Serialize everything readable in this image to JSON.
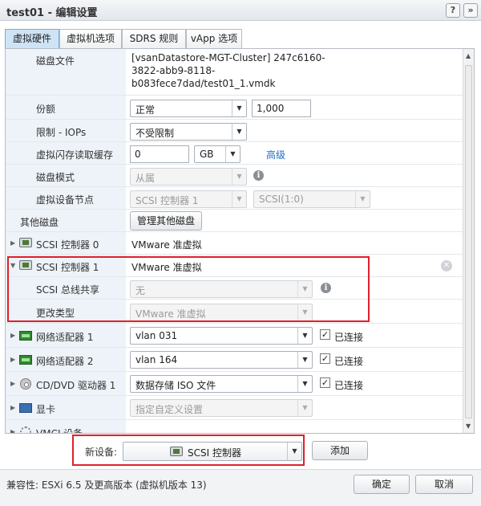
{
  "window": {
    "title": "test01 - 编辑设置",
    "help_glyph": "?",
    "expand_glyph": "»"
  },
  "tabs": [
    {
      "label": "虚拟硬件",
      "active": true
    },
    {
      "label": "虚拟机选项",
      "active": false
    },
    {
      "label": "SDRS 规则",
      "active": false
    },
    {
      "label": "vApp 选项",
      "active": false
    }
  ],
  "disk": {
    "file_label": "磁盘文件",
    "file_lines": [
      "[vsanDatastore-MGT-Cluster] 247c6160-",
      "3822-abb9-8118-",
      "b083fece7dad/test01_1.vmdk"
    ],
    "shares_label": "份额",
    "shares_value": "正常",
    "shares_number": "1,000",
    "limit_label": "限制 - IOPs",
    "limit_value": "不受限制",
    "flash_label": "虚拟闪存读取缓存",
    "flash_value": "0",
    "flash_unit": "GB",
    "flash_advanced": "高级",
    "mode_label": "磁盘模式",
    "mode_value": "从属",
    "node_label": "虚拟设备节点",
    "node_controller": "SCSI 控制器 1",
    "node_slot": "SCSI(1:0)"
  },
  "other_disks": {
    "label": "其他磁盘",
    "button": "管理其他磁盘"
  },
  "devices": {
    "scsi0": {
      "label": "SCSI 控制器 0",
      "value": "VMware 准虚拟"
    },
    "scsi1": {
      "label": "SCSI 控制器 1",
      "value": "VMware 准虚拟",
      "bus_sharing_label": "SCSI 总线共享",
      "bus_sharing_value": "无",
      "change_type_label": "更改类型",
      "change_type_value": "VMware 准虚拟"
    },
    "nic1": {
      "label": "网络适配器 1",
      "value": "vlan 031",
      "connected": "已连接"
    },
    "nic2": {
      "label": "网络适配器 2",
      "value": "vlan 164",
      "connected": "已连接"
    },
    "cdrom": {
      "label": "CD/DVD 驱动器 1",
      "value": "数据存储 ISO 文件",
      "connected": "已连接"
    },
    "video": {
      "label": "显卡",
      "value": "指定自定义设置"
    },
    "vmci": {
      "label": "VMCI 设备"
    }
  },
  "new_device": {
    "label": "新设备:",
    "value": "SCSI 控制器",
    "add_button": "添加"
  },
  "footer": {
    "compat": "兼容性: ESXi 6.5 及更高版本 (虚拟机版本 13)",
    "ok": "确定",
    "cancel": "取消"
  },
  "colors": {
    "highlight_red": "#e0202a",
    "link_blue": "#1f6fc2",
    "active_tab": "#cfe3f6"
  }
}
